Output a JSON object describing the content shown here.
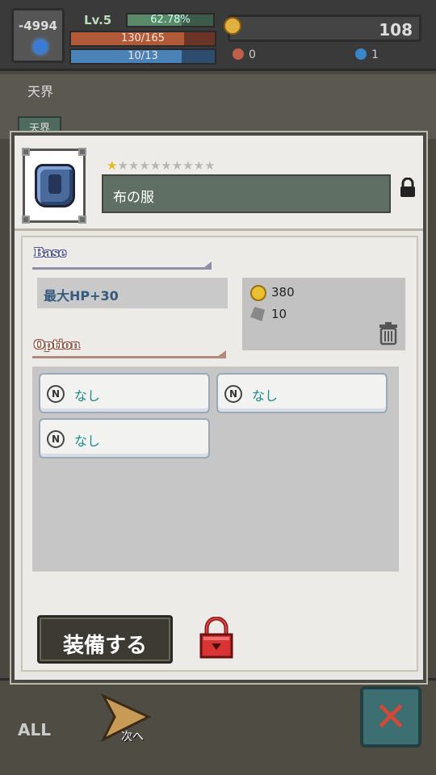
{
  "status": {
    "level_box_value": "-4994",
    "level_label": "Lv.5",
    "exp_percent": "62.78%",
    "exp_fraction": 0.6278,
    "hp": "130/165",
    "hp_fraction": 0.788,
    "mp": "10/13",
    "mp_fraction": 0.769,
    "gold": "108",
    "resource_a": "0",
    "resource_b": "1"
  },
  "scene": {
    "area_label": "天界",
    "tab_label": "天界"
  },
  "item": {
    "rarity_stars_filled": 1,
    "rarity_stars_total": 10,
    "name": "布の服",
    "locked": true
  },
  "sections": {
    "base_title": "Base",
    "option_title": "Option"
  },
  "base_stat": "最大HP+30",
  "price": {
    "gold": "380",
    "ore": "10"
  },
  "options": [
    {
      "badge": "N",
      "label": "なし"
    },
    {
      "badge": "N",
      "label": "なし"
    },
    {
      "badge": "N",
      "label": "なし"
    }
  ],
  "actions": {
    "equip_label": "装備する",
    "next_label": "次へ",
    "all_label": "ALL"
  },
  "colors": {
    "name_box": "#5f6f63",
    "option_text": "#1a8a8a",
    "stat_text": "#355a7d",
    "close_x": "#d04a38"
  }
}
